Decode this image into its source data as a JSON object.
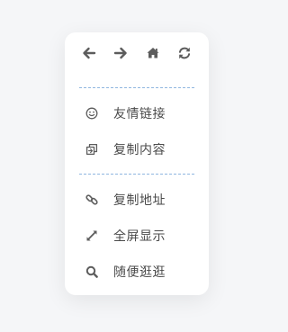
{
  "toolbar": {
    "buttons": [
      {
        "icon": "arrow-left-icon"
      },
      {
        "icon": "arrow-right-icon"
      },
      {
        "icon": "home-icon"
      },
      {
        "icon": "refresh-icon"
      }
    ]
  },
  "menu": {
    "items": [
      {
        "icon": "smile-icon",
        "label": "友情链接"
      },
      {
        "icon": "copy-icon",
        "label": "复制内容"
      },
      {
        "icon": "link-icon",
        "label": "复制地址"
      },
      {
        "icon": "expand-icon",
        "label": "全屏显示"
      },
      {
        "icon": "search-icon",
        "label": "随便逛逛"
      }
    ]
  },
  "colors": {
    "icon": "#5c5c5c",
    "text": "#4a4a4a",
    "divider": "#8fb6e0",
    "background": "#f5f6f8",
    "panel": "#ffffff"
  }
}
